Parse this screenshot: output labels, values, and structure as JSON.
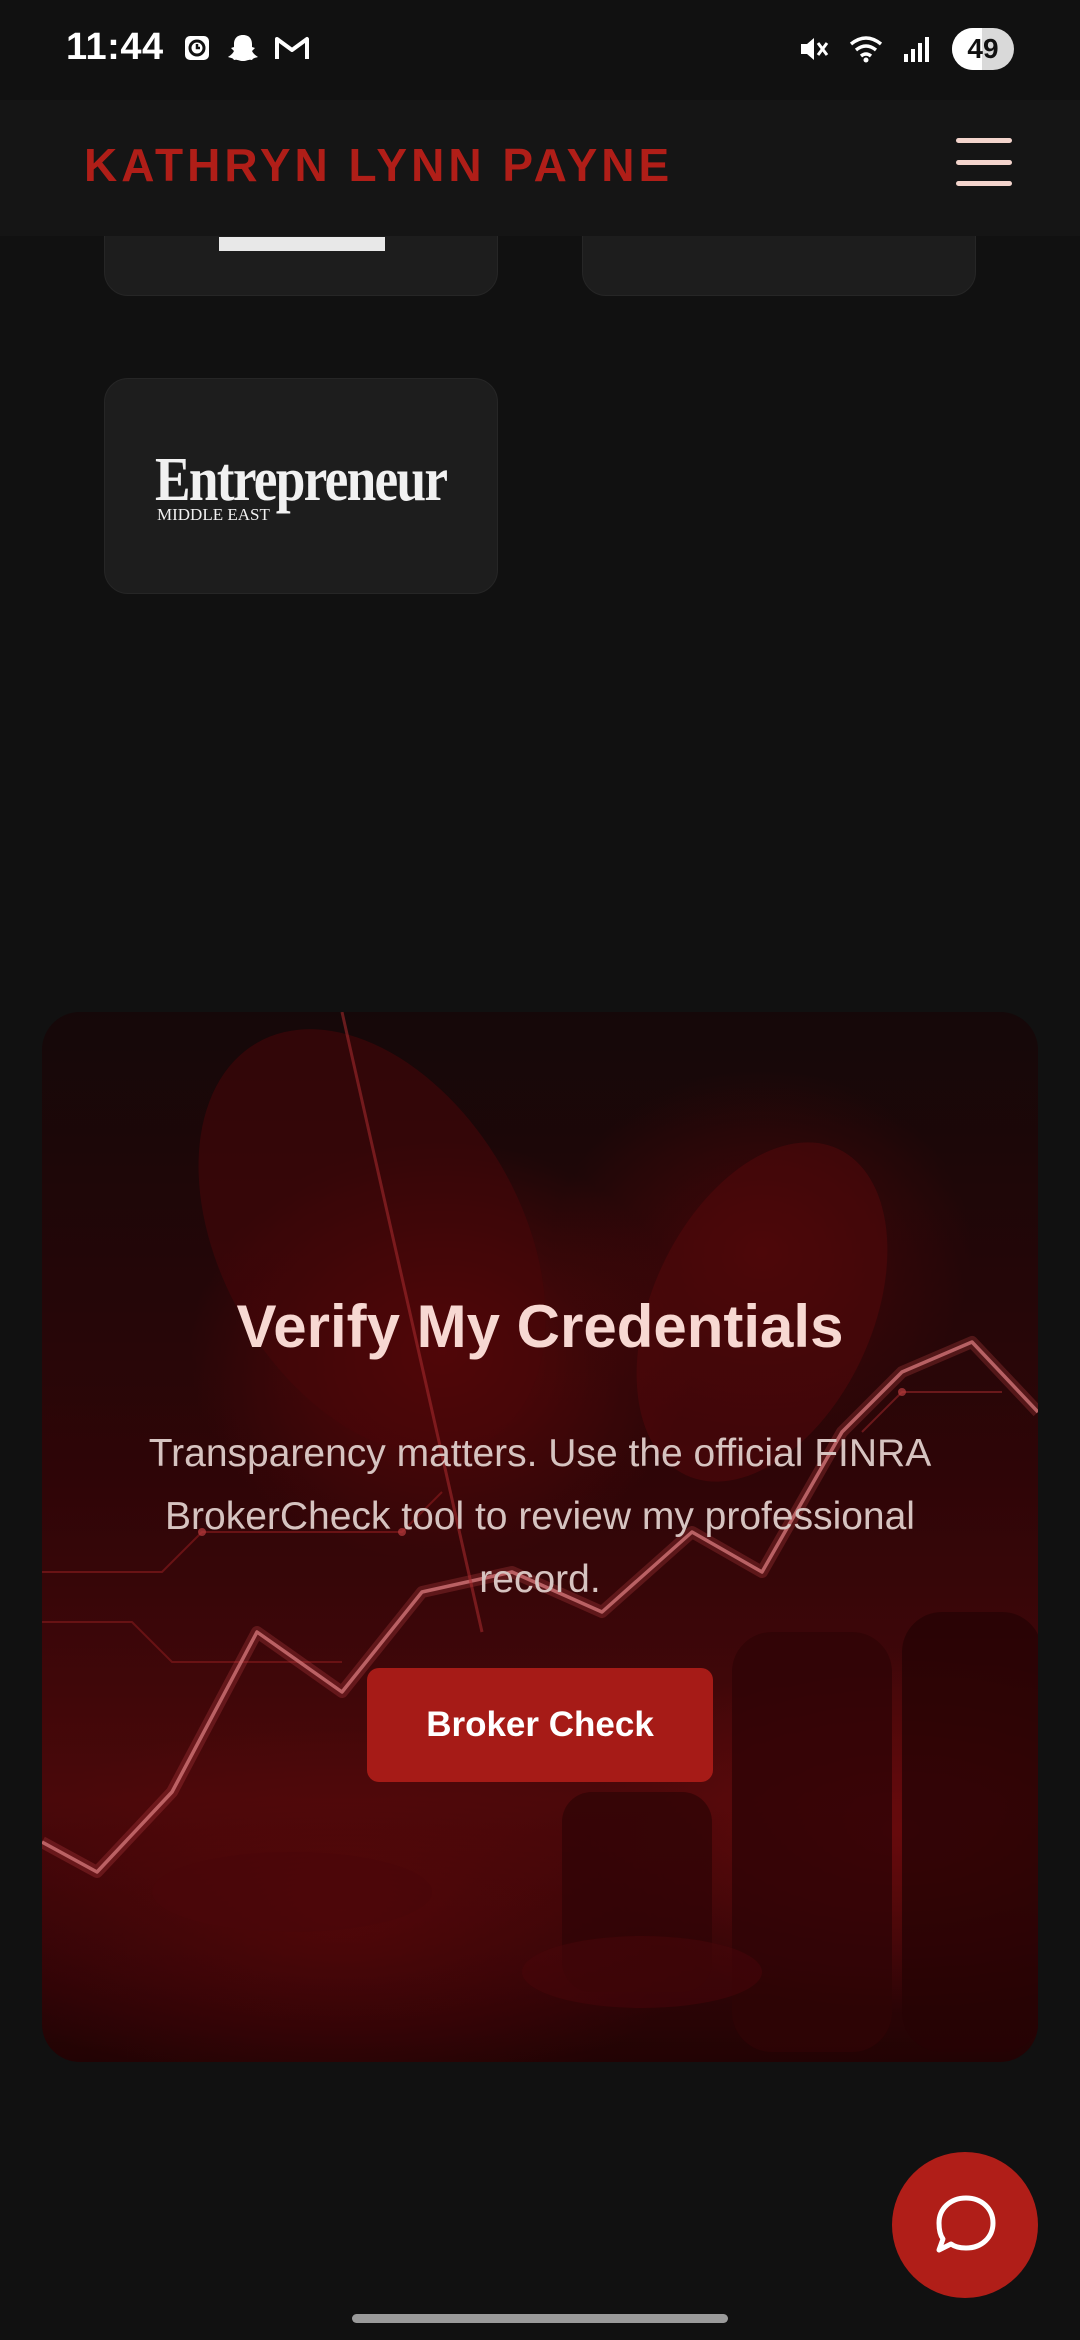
{
  "status_bar": {
    "time": "11:44",
    "battery_level": "49",
    "battery_fraction": 0.49,
    "left_icons": [
      "clock-app-icon",
      "snapchat-icon",
      "gmail-icon"
    ],
    "right_icons": [
      "vibrate-mute-icon",
      "wifi-icon",
      "cell-signal-icon",
      "battery-icon"
    ]
  },
  "header": {
    "brand": "KATHRYN LYNN PAYNE",
    "brand_color": "#b01e18",
    "menu_icon": "hamburger-menu-icon"
  },
  "press": {
    "logos": [
      {
        "name": "partial-logo"
      },
      {
        "name": "empty-logo"
      },
      {
        "name": "entrepreneur-middle-east",
        "word": "Entrepreneur",
        "sub": "MIDDLE EAST"
      }
    ]
  },
  "credentials": {
    "title": "Verify My Credentials",
    "description": "Transparency matters. Use the official FINRA BrokerCheck tool to review my professional record.",
    "button_label": "Broker Check",
    "accent": "#a61b17"
  },
  "chat": {
    "icon": "chat-bubble-icon"
  }
}
